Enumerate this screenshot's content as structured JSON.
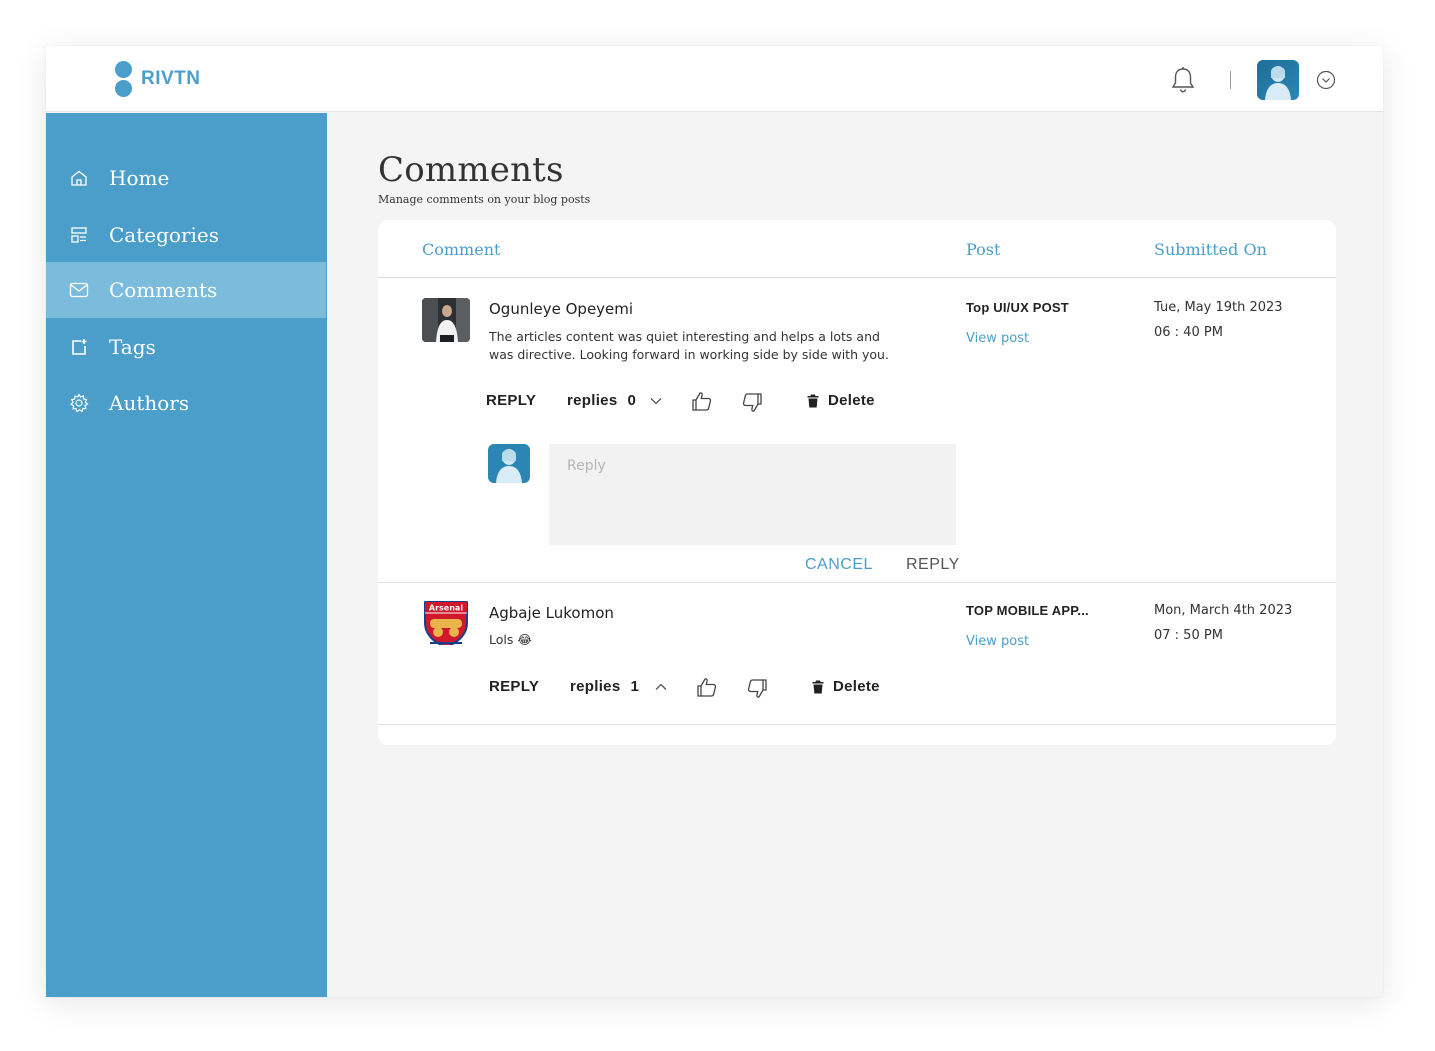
{
  "app": {
    "name": "RIVTN"
  },
  "colors": {
    "accent": "#4a9ec9",
    "sidebar": "#4a9ec9",
    "sidebar_active": "#7bbcdd",
    "background": "#f4f4f4"
  },
  "header": {
    "icons": [
      "bell-icon",
      "avatar",
      "chevron-down-circle-icon"
    ]
  },
  "sidebar": {
    "items": [
      {
        "label": "Home",
        "icon": "home-icon",
        "active": false
      },
      {
        "label": "Categories",
        "icon": "categories-icon",
        "active": false
      },
      {
        "label": "Comments",
        "icon": "mail-icon",
        "active": true
      },
      {
        "label": "Tags",
        "icon": "tag-icon",
        "active": false
      },
      {
        "label": "Authors",
        "icon": "gear-icon",
        "active": false
      }
    ]
  },
  "main": {
    "title": "Comments",
    "subtitle": "Manage comments on your blog posts",
    "columns": {
      "comment": "Comment",
      "post": "Post",
      "submitted": "Submitted On"
    },
    "comments": [
      {
        "author": "Ogunleye Opeyemi",
        "text": "The articles content was quiet interesting and helps a lots and was directive. Looking forward in working side by side with you.",
        "reply_label": "REPLY",
        "replies_label": "replies",
        "replies_count": "0",
        "delete_label": "Delete",
        "post_title": "Top UI/UX POST",
        "view_post": "View post",
        "date": "Tue, May 19th 2023",
        "time": "06 : 40 PM"
      },
      {
        "author": "Agbaje Lukomon",
        "text": "Lols 😂",
        "reply_label": "REPLY",
        "replies_label": "replies",
        "replies_count": "1",
        "delete_label": "Delete",
        "post_title": "TOP MOBILE APP...",
        "view_post": "View post",
        "date": "Mon, March 4th 2023",
        "time": "07 : 50 PM"
      }
    ],
    "reply_form": {
      "placeholder": "Reply",
      "value": "",
      "cancel_label": "CANCEL",
      "reply_label": "REPLY"
    }
  }
}
